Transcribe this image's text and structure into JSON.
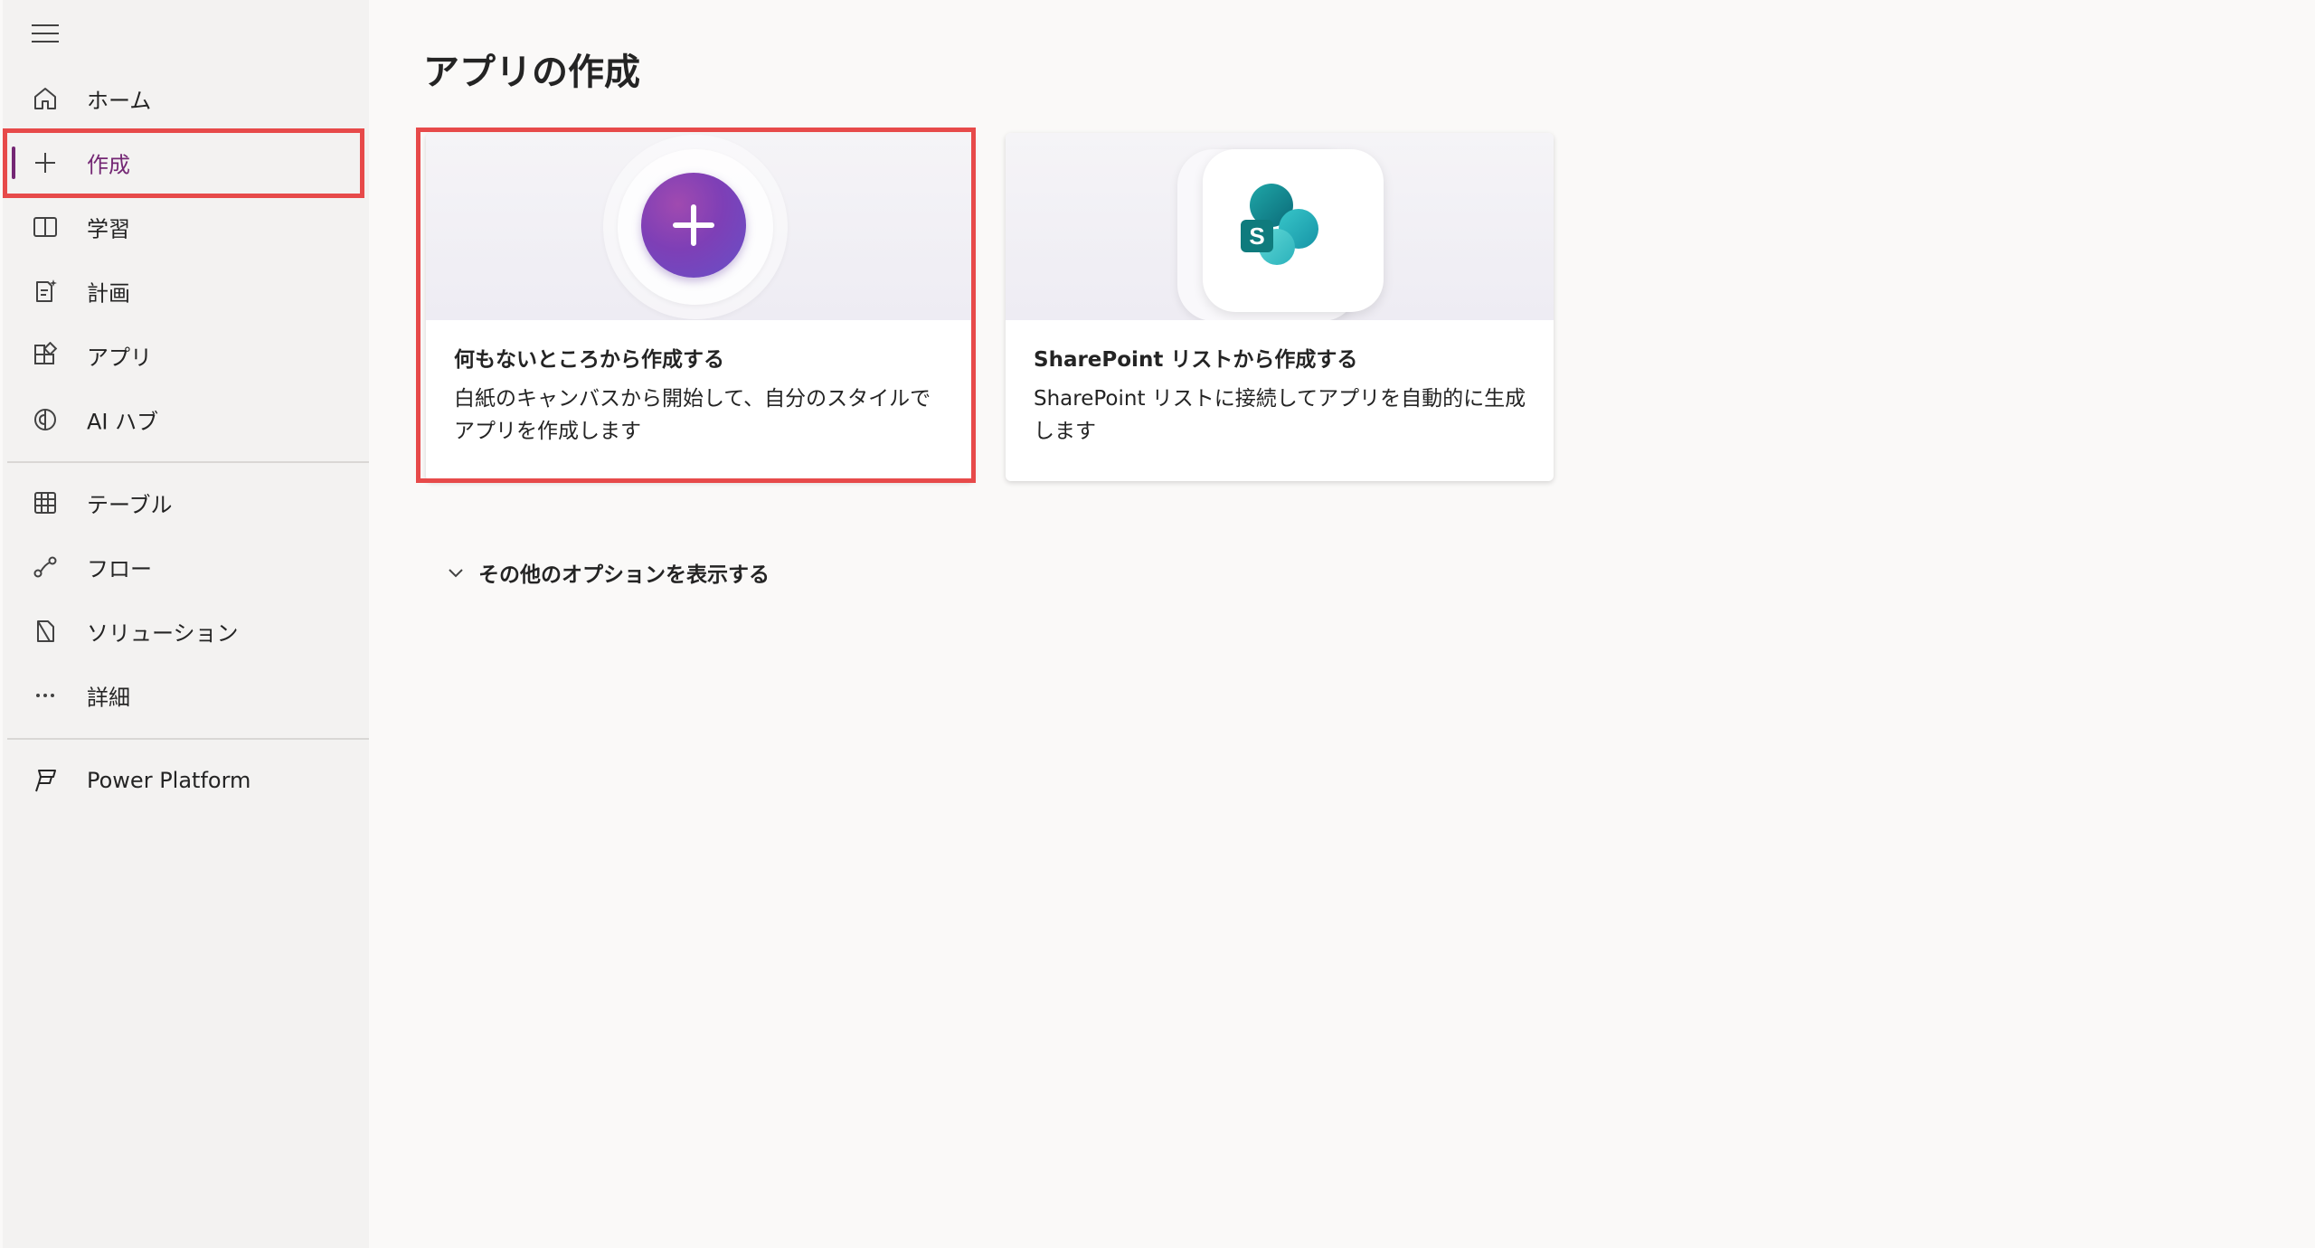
{
  "sidebar": {
    "menu_icon": "hamburger-icon",
    "items": [
      {
        "id": "home",
        "label": "ホーム",
        "icon": "home-icon"
      },
      {
        "id": "create",
        "label": "作成",
        "icon": "plus-icon",
        "active": true
      },
      {
        "id": "learn",
        "label": "学習",
        "icon": "book-icon"
      },
      {
        "id": "plan",
        "label": "計画",
        "icon": "plan-icon"
      },
      {
        "id": "apps",
        "label": "アプリ",
        "icon": "apps-icon"
      },
      {
        "id": "ai-hub",
        "label": "AI ハブ",
        "icon": "ai-brain-icon"
      },
      {
        "id": "tables",
        "label": "テーブル",
        "icon": "table-icon"
      },
      {
        "id": "flows",
        "label": "フロー",
        "icon": "flow-icon"
      },
      {
        "id": "solutions",
        "label": "ソリューション",
        "icon": "solution-icon"
      },
      {
        "id": "more",
        "label": "詳細",
        "icon": "more-icon"
      },
      {
        "id": "power-platform",
        "label": "Power Platform",
        "icon": "power-platform-icon"
      }
    ]
  },
  "main": {
    "title": "アプリの作成",
    "cards": [
      {
        "id": "blank",
        "title": "何もないところから作成する",
        "description": "白紙のキャンバスから開始して、自分のスタイルでアプリを作成します",
        "icon": "plus-icon"
      },
      {
        "id": "sharepoint",
        "title": "SharePoint リストから作成する",
        "description": "SharePoint リストに接続してアプリを自動的に生成します",
        "icon": "sharepoint-icon",
        "icon_letter": "S"
      }
    ],
    "more_options": {
      "label": "その他のオプションを表示する",
      "icon": "chevron-down-icon"
    }
  },
  "colors": {
    "accent": "#742774",
    "highlight": "#e74a4a",
    "background": "#faf9f8",
    "sidebar": "#f3f2f1"
  }
}
